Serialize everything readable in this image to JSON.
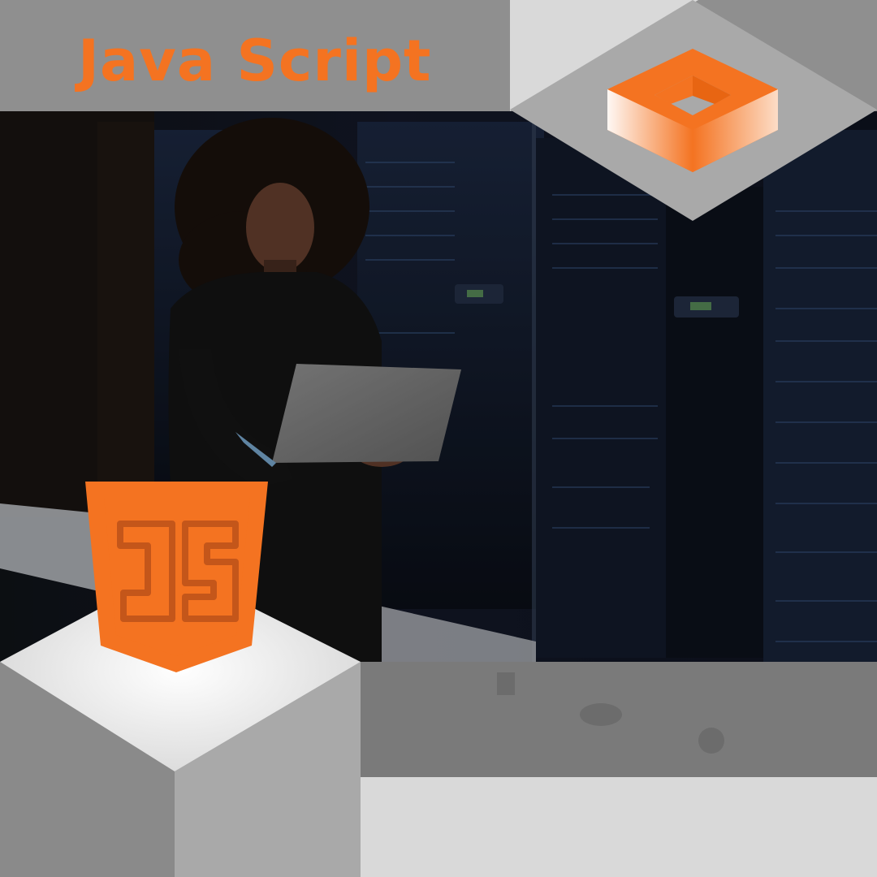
{
  "title": "Java Script",
  "colors": {
    "accent": "#f47321",
    "title_band": "#8f8f8f",
    "panel_light": "#d9d9d9",
    "panel_mid": "#a9a9a9",
    "server_room_dark": "#0f131b",
    "rack_blue": "#2b4466"
  },
  "icons": {
    "js_badge": "javascript-shield-logo",
    "top_right": "isometric-orange-frame"
  },
  "js_badge_letters": "JS"
}
